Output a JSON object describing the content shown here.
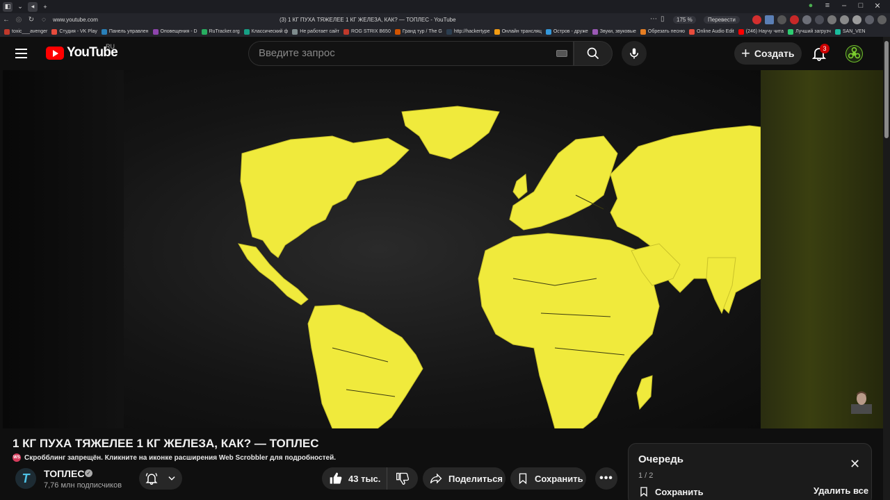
{
  "browser": {
    "url": "www.youtube.com",
    "tab_title": "(3) 1 КГ ПУХА ТЯЖЕЛЕЕ 1 КГ ЖЕЛЕЗА, КАК? — ТОПЛЕС - YouTube",
    "zoom": "175 %",
    "translate_label": "Перевести",
    "bookmarks": [
      {
        "label": "toxic___avenger",
        "color": "#c0392b"
      },
      {
        "label": "Студия - VK Play",
        "color": "#e74c3c"
      },
      {
        "label": "Панель управлен",
        "color": "#2980b9"
      },
      {
        "label": "Оповещения - D",
        "color": "#8e44ad"
      },
      {
        "label": "RuTracker.org",
        "color": "#27ae60"
      },
      {
        "label": "Классический ф",
        "color": "#16a085"
      },
      {
        "label": "Не работает сайт",
        "color": "#7f8c8d"
      },
      {
        "label": "ROG STRIX B650",
        "color": "#c0392b"
      },
      {
        "label": "Гранд тур / The G",
        "color": "#d35400"
      },
      {
        "label": "http://hackertype",
        "color": "#2c3e50"
      },
      {
        "label": "Онлайн трансляц",
        "color": "#f39c12"
      },
      {
        "label": "Остров - друже",
        "color": "#3498db"
      },
      {
        "label": "Звуки, звуковые",
        "color": "#9b59b6"
      },
      {
        "label": "Обрезать песню",
        "color": "#e67e22"
      },
      {
        "label": "Online Audio Edit",
        "color": "#e74c3c"
      },
      {
        "label": "(246) Научу чита",
        "color": "#ff0000"
      },
      {
        "label": "Лучший загрузч",
        "color": "#2ecc71"
      },
      {
        "label": "SAN_VEN",
        "color": "#1abc9c"
      }
    ]
  },
  "masthead": {
    "logo_text": "YouTube",
    "country_code": "RU",
    "search_placeholder": "Введите запрос",
    "create_label": "Создать",
    "notifications_count": "3"
  },
  "video": {
    "title": "1 КГ ПУХА ТЯЖЕЛЕЕ 1 КГ ЖЕЛЕЗА, КАК? — ТОПЛЕС",
    "scrobbler_notice": "Скробблинг запрещён. Кликните на иконке расширения Web Scrobbler для подробностей.",
    "scrobbler_icon_text": "WS",
    "map_color": "#f0ea3c"
  },
  "channel": {
    "avatar_letter": "T",
    "name": "ТОПЛЕС",
    "subscribers": "7,76 млн подписчиков"
  },
  "actions": {
    "likes": "43 тыс.",
    "share_label": "Поделиться",
    "save_label": "Сохранить"
  },
  "queue": {
    "title": "Очередь",
    "count": "1 / 2",
    "save_label": "Сохранить",
    "clear_label": "Удалить все"
  }
}
